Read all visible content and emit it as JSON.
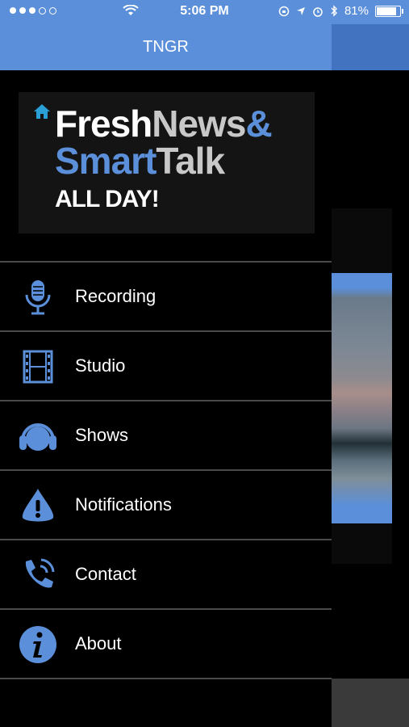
{
  "status_bar": {
    "time": "5:06 PM",
    "battery": "81%",
    "signal_dots_filled": 3,
    "signal_dots_total": 5
  },
  "header": {
    "title": "TNGR"
  },
  "logo": {
    "line1_part1": "Fresh",
    "line1_part2": "News",
    "line1_part3": "&",
    "line2_part1": "Smart",
    "line2_part2": "Talk",
    "line3": "ALL DAY!"
  },
  "menu": {
    "items": [
      {
        "label": "Recording",
        "icon": "microphone-icon"
      },
      {
        "label": "Studio",
        "icon": "film-strip-icon"
      },
      {
        "label": "Shows",
        "icon": "headphones-icon"
      },
      {
        "label": "Notifications",
        "icon": "alert-icon"
      },
      {
        "label": "Contact",
        "icon": "phone-icon"
      },
      {
        "label": "About",
        "icon": "info-icon"
      }
    ]
  },
  "colors": {
    "accent": "#5b8fd9",
    "drawer_bg": "#000000",
    "divider": "#4a4a4a"
  }
}
